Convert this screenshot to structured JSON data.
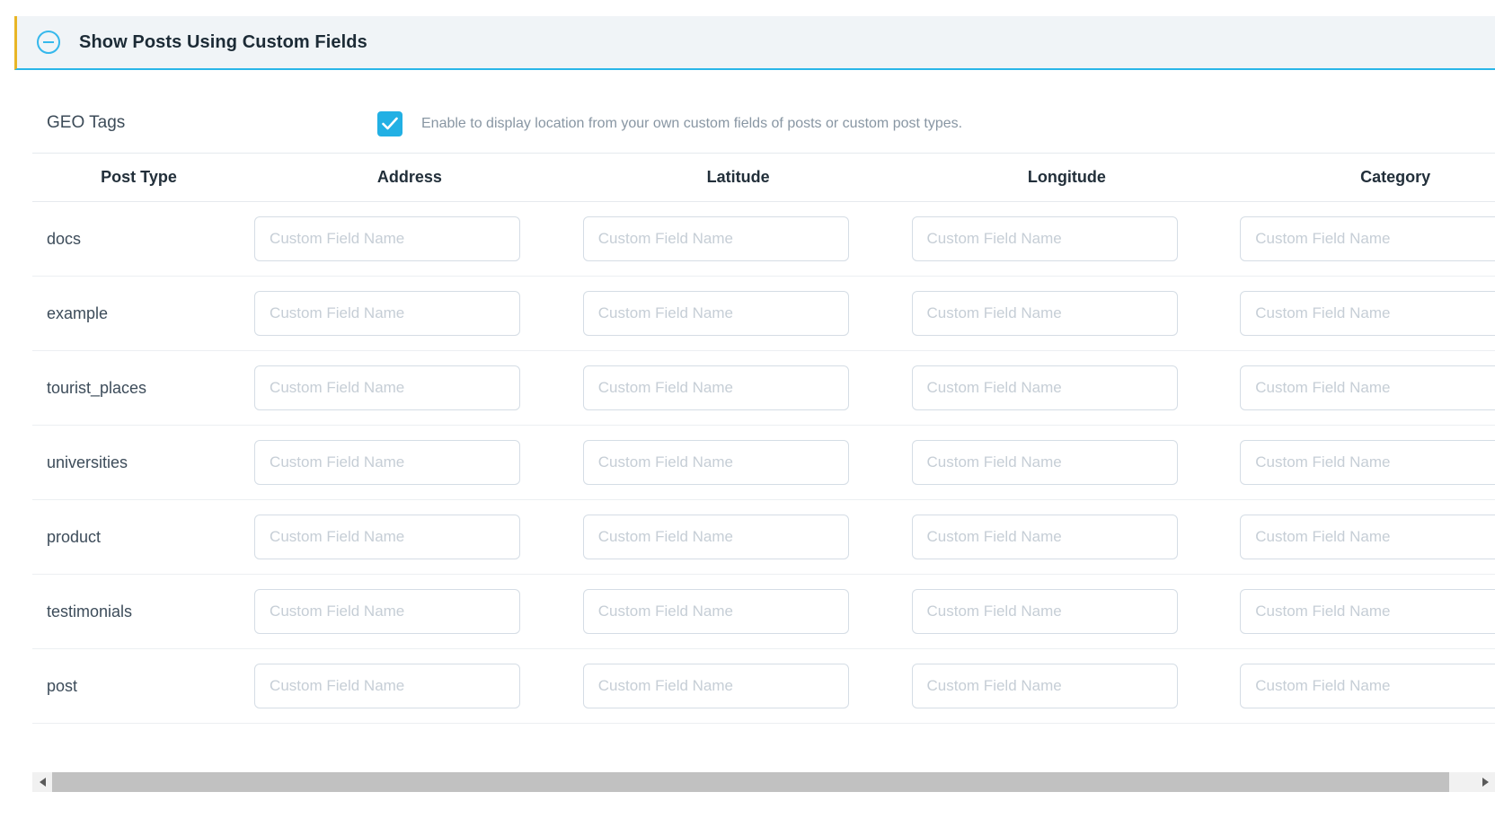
{
  "panel": {
    "title": "Show Posts Using Custom Fields",
    "collapse_icon": "minus-circle-icon",
    "accent_left_color": "#e8b525",
    "accent_bottom_color": "#29b6e8",
    "header_bg": "#f0f4f7"
  },
  "geo": {
    "label": "GEO Tags",
    "checkbox_checked": true,
    "checkbox_color": "#22b0e4",
    "description": "Enable to display location from your own custom fields of posts or custom post types."
  },
  "table": {
    "columns": [
      "Post Type",
      "Address",
      "Latitude",
      "Longitude",
      "Category"
    ],
    "field_placeholder": "Custom Field Name",
    "rows": [
      {
        "post_type": "docs",
        "address": "",
        "latitude": "",
        "longitude": "",
        "category": ""
      },
      {
        "post_type": "example",
        "address": "",
        "latitude": "",
        "longitude": "",
        "category": ""
      },
      {
        "post_type": "tourist_places",
        "address": "",
        "latitude": "",
        "longitude": "",
        "category": ""
      },
      {
        "post_type": "universities",
        "address": "",
        "latitude": "",
        "longitude": "",
        "category": ""
      },
      {
        "post_type": "product",
        "address": "",
        "latitude": "",
        "longitude": "",
        "category": ""
      },
      {
        "post_type": "testimonials",
        "address": "",
        "latitude": "",
        "longitude": "",
        "category": ""
      },
      {
        "post_type": "post",
        "address": "",
        "latitude": "",
        "longitude": "",
        "category": ""
      }
    ]
  },
  "scrollbar": {
    "left_arrow_icon": "triangle-left-icon",
    "right_arrow_icon": "triangle-right-icon",
    "thumb_color": "#c1c1c1"
  }
}
